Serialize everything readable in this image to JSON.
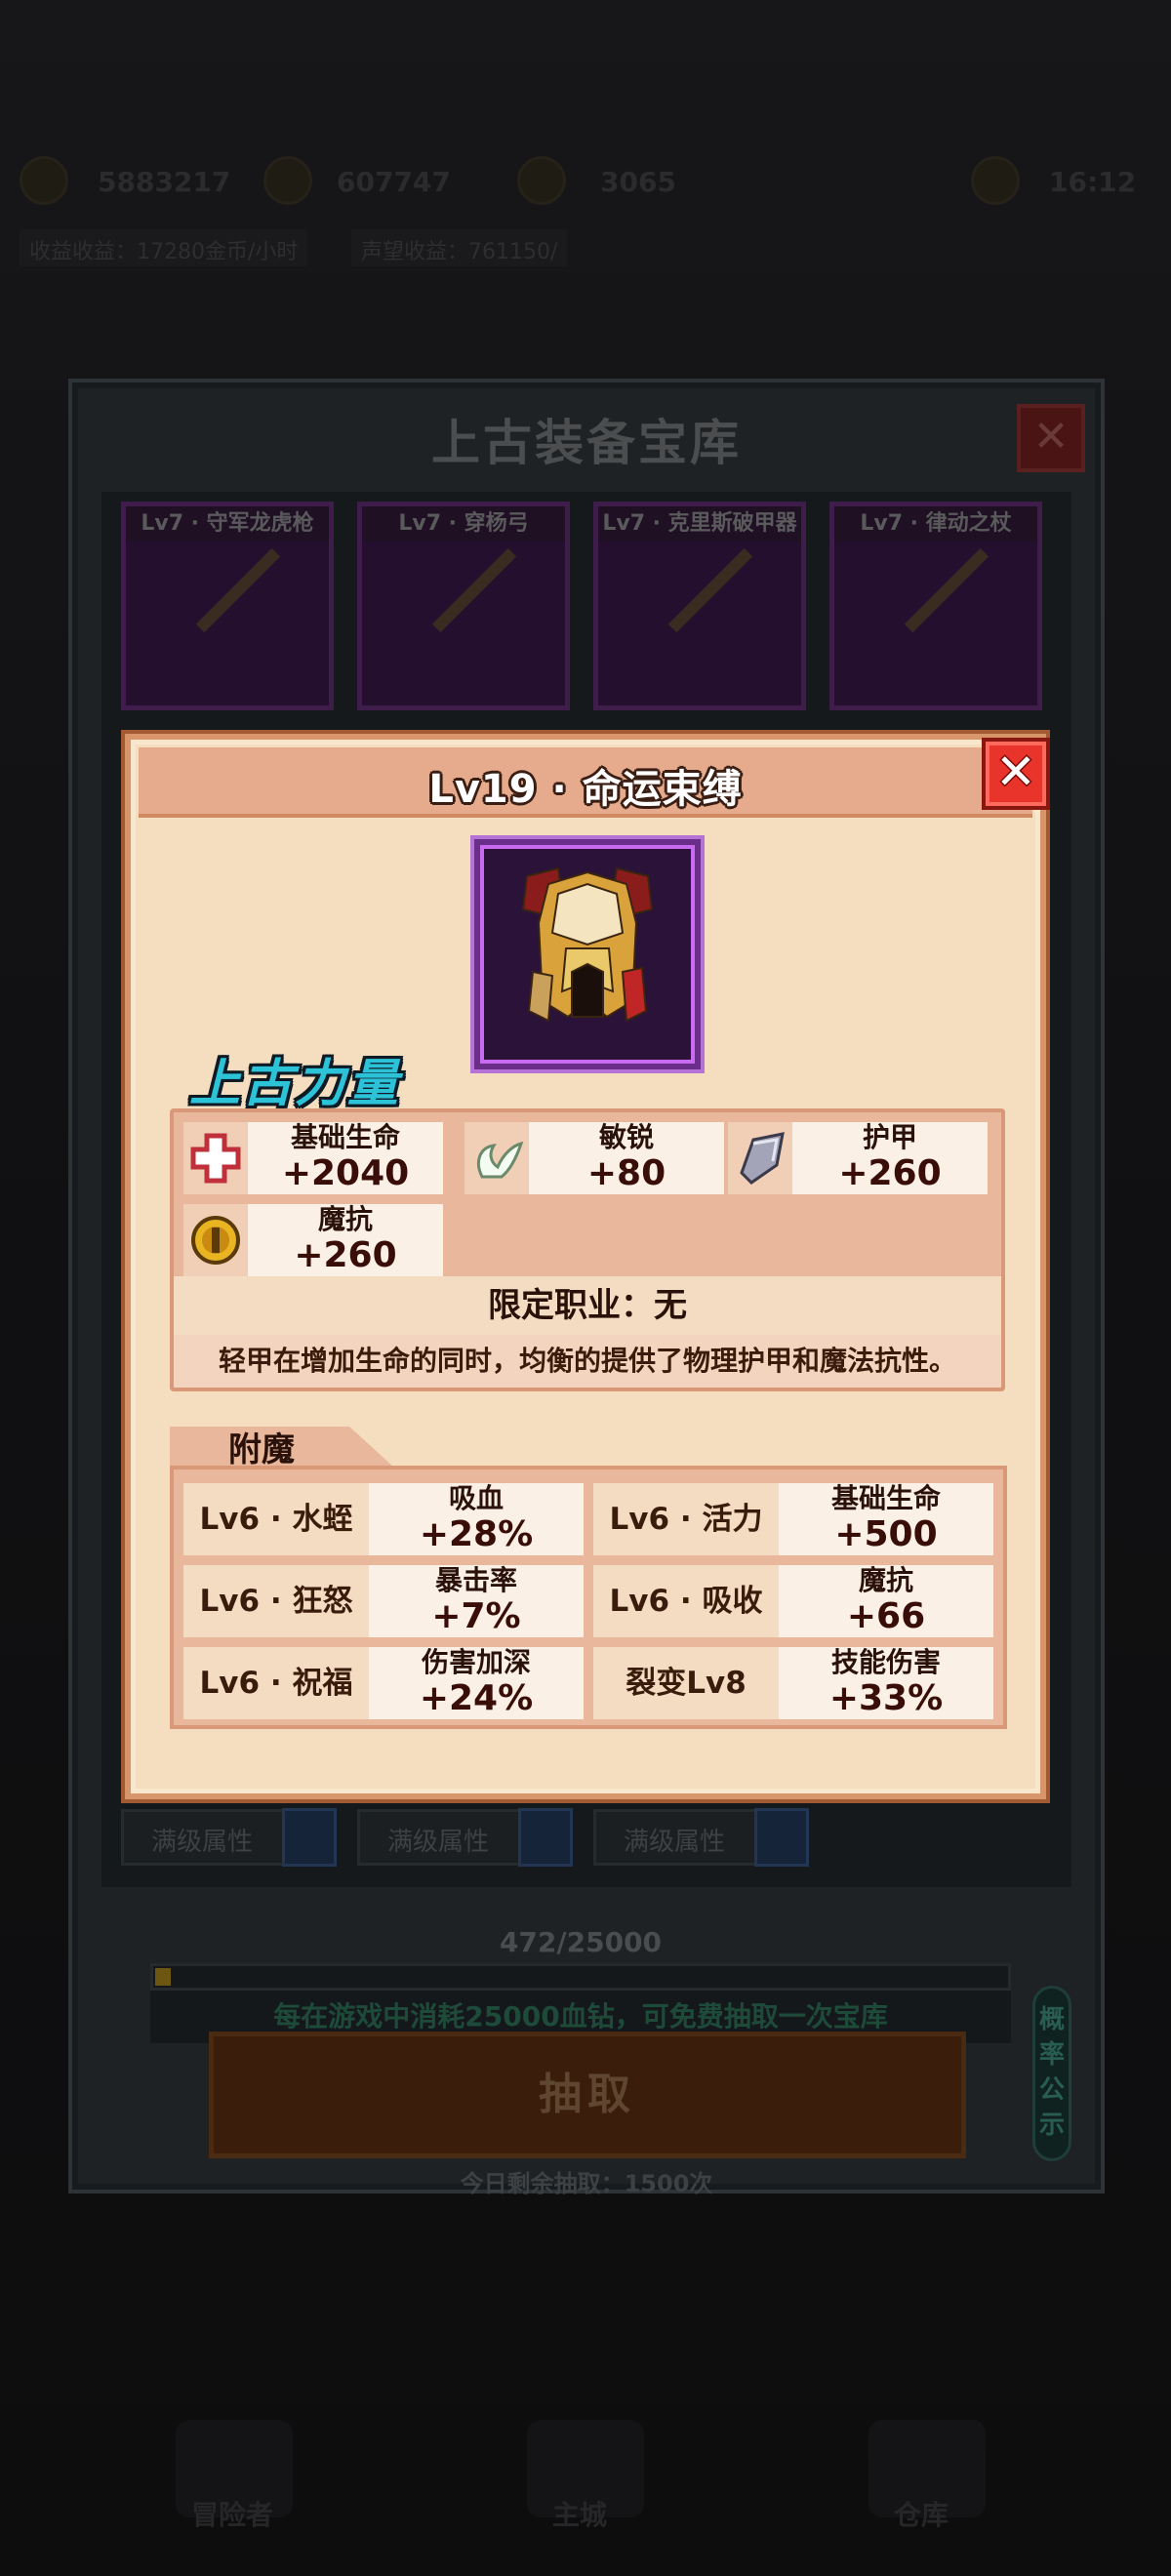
{
  "background": {
    "stats": [
      "5883217",
      "607747",
      "3065"
    ],
    "clock": "16:12",
    "chips": [
      "收益收益：17280金币/小时",
      "声望收益：761150/"
    ],
    "nav": [
      "冒险者",
      "主城",
      "仓库"
    ]
  },
  "vault": {
    "title": "上古装备宝库",
    "close_label": "✕",
    "items": [
      "Lv7 · 守军龙虎枪",
      "Lv7 · 穿杨弓",
      "Lv7 · 克里斯破甲器",
      "Lv7 · 律动之杖"
    ],
    "max_attr_label": "满级属性",
    "progress": {
      "text": "472/25000",
      "current": 472,
      "total": 25000
    },
    "hint": "每在游戏中消耗25000血钻，可免费抽取一次宝库",
    "draw_label": "抽取",
    "daily_remaining": "今日剩余抽取：1500次",
    "probability_label": "概率公示"
  },
  "modal": {
    "title": "Lv19 · 命运束缚",
    "close_label": "✕",
    "equip_icon": "golden-armor-icon",
    "section_title": "上古力量",
    "attributes": [
      {
        "icon": "health-cross-icon",
        "name": "基础生命",
        "value": "+2040"
      },
      {
        "icon": "wings-icon",
        "name": "敏锐",
        "value": "+80"
      },
      {
        "icon": "shield-icon",
        "name": "护甲",
        "value": "+260"
      },
      {
        "icon": "magic-resist-coin-icon",
        "name": "魔抗",
        "value": "+260"
      }
    ],
    "job_restriction": "限定职业：无",
    "description": "轻甲在增加生命的同时，均衡的提供了物理护甲和魔法抗性。",
    "enchant_title": "附魔",
    "enchants": [
      {
        "key": "Lv6 · 水蛭",
        "name": "吸血",
        "value": "+28%"
      },
      {
        "key": "Lv6 · 活力",
        "name": "基础生命",
        "value": "+500"
      },
      {
        "key": "Lv6 · 狂怒",
        "name": "暴击率",
        "value": "+7%"
      },
      {
        "key": "Lv6 · 吸收",
        "name": "魔抗",
        "value": "+66"
      },
      {
        "key": "Lv6 · 祝福",
        "name": "伤害加深",
        "value": "+24%"
      },
      {
        "key": "裂变Lv8",
        "name": "技能伤害",
        "value": "+33%"
      }
    ]
  },
  "colors": {
    "modal_bg": "#f4debf",
    "modal_border": "#d89569",
    "section_title": "#2cc3d8",
    "close_red": "#e8342a",
    "frame_purple": "#6a2d8a"
  }
}
